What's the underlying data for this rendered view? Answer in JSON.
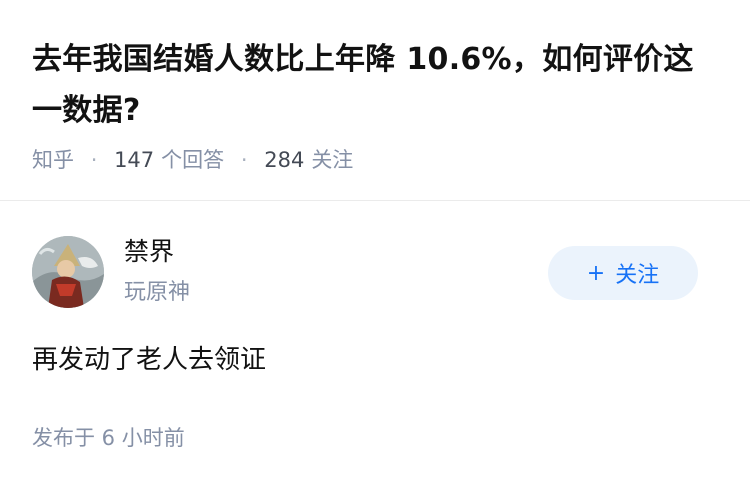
{
  "question": {
    "title": "去年我国结婚人数比上年降 10.6%，如何评价这一数据?",
    "source": "知乎",
    "answer_count": "147",
    "answer_label": "个回答",
    "follow_count": "284",
    "follow_label": "关注"
  },
  "answer": {
    "author": {
      "name": "禁界",
      "bio": "玩原神",
      "avatar_icon": "avatar-image"
    },
    "follow_button": {
      "icon": "plus",
      "label": "关注"
    },
    "content": "再发动了老人去领证",
    "published": "发布于 6 小时前"
  },
  "colors": {
    "accent": "#1772f6",
    "button_bg": "#ebf3fc",
    "meta_text": "#8590a6"
  }
}
